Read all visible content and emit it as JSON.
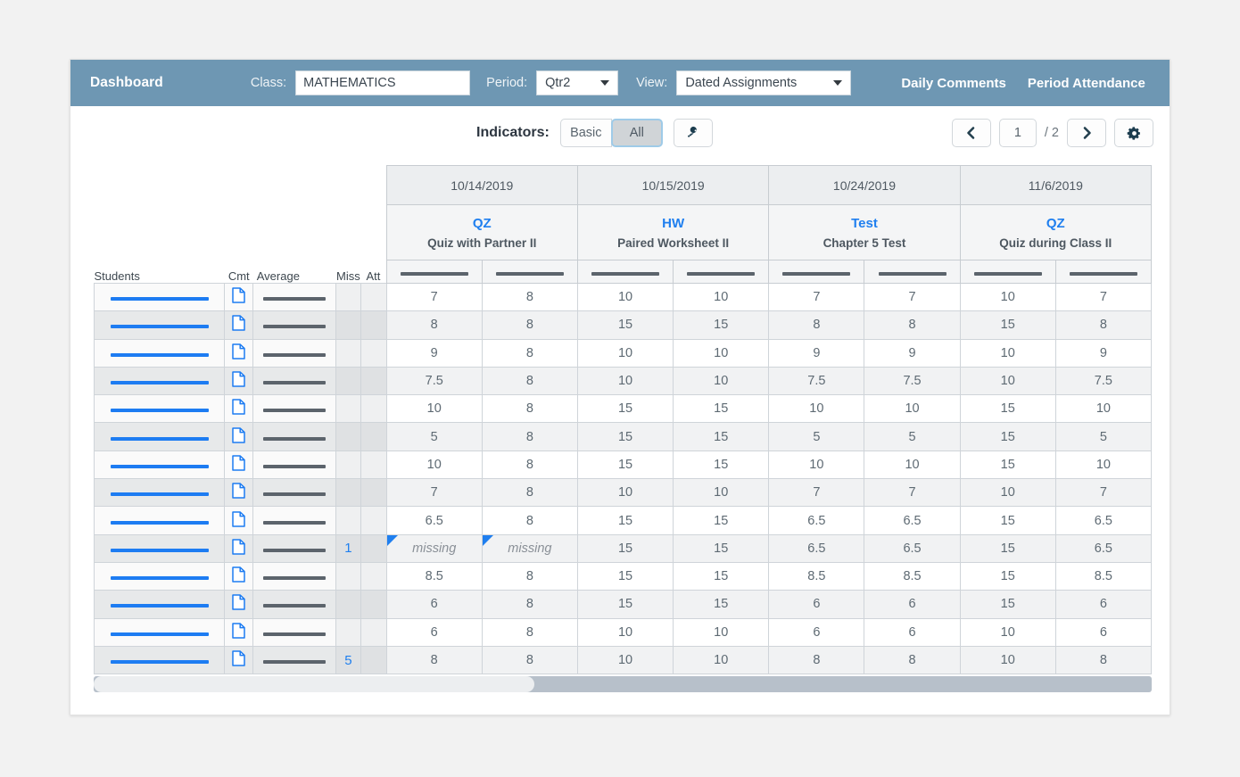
{
  "topbar": {
    "title": "Dashboard",
    "class_label": "Class:",
    "class_value": "MATHEMATICS",
    "period_label": "Period:",
    "period_value": "Qtr2",
    "view_label": "View:",
    "view_value": "Dated Assignments",
    "daily_comments": "Daily Comments",
    "period_attendance": "Period Attendance",
    "bg_color": "#6e97b3"
  },
  "toolbar": {
    "indicators_label": "Indicators:",
    "basic_label": "Basic",
    "all_label": "All",
    "all_selected": true,
    "key_icon": "key-icon",
    "prev_icon": "chevron-left-icon",
    "next_icon": "chevron-right-icon",
    "settings_icon": "gear-icon",
    "page_number": "1",
    "page_total": "/ 2"
  },
  "grid": {
    "columns": {
      "students": "Students",
      "cmt": "Cmt",
      "average": "Average",
      "miss": "Miss",
      "att": "Att"
    },
    "assignments": [
      {
        "date": "10/14/2019",
        "type": "QZ",
        "name": "Quiz with Partner II"
      },
      {
        "date": "10/15/2019",
        "type": "HW",
        "name": "Paired Worksheet II"
      },
      {
        "date": "10/24/2019",
        "type": "Test",
        "name": "Chapter 5 Test"
      },
      {
        "date": "11/6/2019",
        "type": "QZ",
        "name": "Quiz during Class II"
      }
    ],
    "accent_blue": "#1f7fef",
    "missing_text": "missing",
    "rows": [
      {
        "miss": "",
        "att": "",
        "scores": [
          "7",
          "8",
          "10",
          "10",
          "7",
          "7",
          "10",
          "7"
        ],
        "flags": [
          false,
          false,
          false,
          false,
          false,
          false,
          false,
          false
        ]
      },
      {
        "miss": "",
        "att": "",
        "scores": [
          "8",
          "8",
          "15",
          "15",
          "8",
          "8",
          "15",
          "8"
        ],
        "flags": [
          false,
          false,
          false,
          false,
          false,
          false,
          false,
          false
        ]
      },
      {
        "miss": "",
        "att": "",
        "scores": [
          "9",
          "8",
          "10",
          "10",
          "9",
          "9",
          "10",
          "9"
        ],
        "flags": [
          false,
          false,
          false,
          false,
          false,
          false,
          false,
          false
        ]
      },
      {
        "miss": "",
        "att": "",
        "scores": [
          "7.5",
          "8",
          "10",
          "10",
          "7.5",
          "7.5",
          "10",
          "7.5"
        ],
        "flags": [
          false,
          false,
          false,
          false,
          false,
          false,
          false,
          false
        ]
      },
      {
        "miss": "",
        "att": "",
        "scores": [
          "10",
          "8",
          "15",
          "15",
          "10",
          "10",
          "15",
          "10"
        ],
        "flags": [
          false,
          false,
          false,
          false,
          false,
          false,
          false,
          false
        ]
      },
      {
        "miss": "",
        "att": "",
        "scores": [
          "5",
          "8",
          "15",
          "15",
          "5",
          "5",
          "15",
          "5"
        ],
        "flags": [
          false,
          false,
          false,
          false,
          false,
          false,
          false,
          false
        ]
      },
      {
        "miss": "",
        "att": "",
        "scores": [
          "10",
          "8",
          "15",
          "15",
          "10",
          "10",
          "15",
          "10"
        ],
        "flags": [
          false,
          false,
          false,
          false,
          false,
          false,
          false,
          false
        ]
      },
      {
        "miss": "",
        "att": "",
        "scores": [
          "7",
          "8",
          "10",
          "10",
          "7",
          "7",
          "10",
          "7"
        ],
        "flags": [
          false,
          false,
          false,
          false,
          false,
          false,
          false,
          false
        ]
      },
      {
        "miss": "",
        "att": "",
        "scores": [
          "6.5",
          "8",
          "15",
          "15",
          "6.5",
          "6.5",
          "15",
          "6.5"
        ],
        "flags": [
          false,
          false,
          false,
          false,
          false,
          false,
          false,
          false
        ]
      },
      {
        "miss": "1",
        "att": "",
        "scores": [
          "missing",
          "missing",
          "15",
          "15",
          "6.5",
          "6.5",
          "15",
          "6.5"
        ],
        "flags": [
          true,
          true,
          false,
          false,
          false,
          false,
          false,
          false
        ]
      },
      {
        "miss": "",
        "att": "",
        "scores": [
          "8.5",
          "8",
          "15",
          "15",
          "8.5",
          "8.5",
          "15",
          "8.5"
        ],
        "flags": [
          false,
          false,
          false,
          false,
          false,
          false,
          false,
          false
        ]
      },
      {
        "miss": "",
        "att": "",
        "scores": [
          "6",
          "8",
          "15",
          "15",
          "6",
          "6",
          "15",
          "6"
        ],
        "flags": [
          false,
          false,
          false,
          false,
          false,
          false,
          false,
          false
        ]
      },
      {
        "miss": "",
        "att": "",
        "scores": [
          "6",
          "8",
          "10",
          "10",
          "6",
          "6",
          "10",
          "6"
        ],
        "flags": [
          false,
          false,
          false,
          false,
          false,
          false,
          false,
          false
        ]
      },
      {
        "miss": "5",
        "att": "",
        "scores": [
          "8",
          "8",
          "10",
          "10",
          "8",
          "8",
          "10",
          "8"
        ],
        "flags": [
          false,
          false,
          false,
          false,
          false,
          false,
          false,
          false
        ]
      }
    ]
  }
}
